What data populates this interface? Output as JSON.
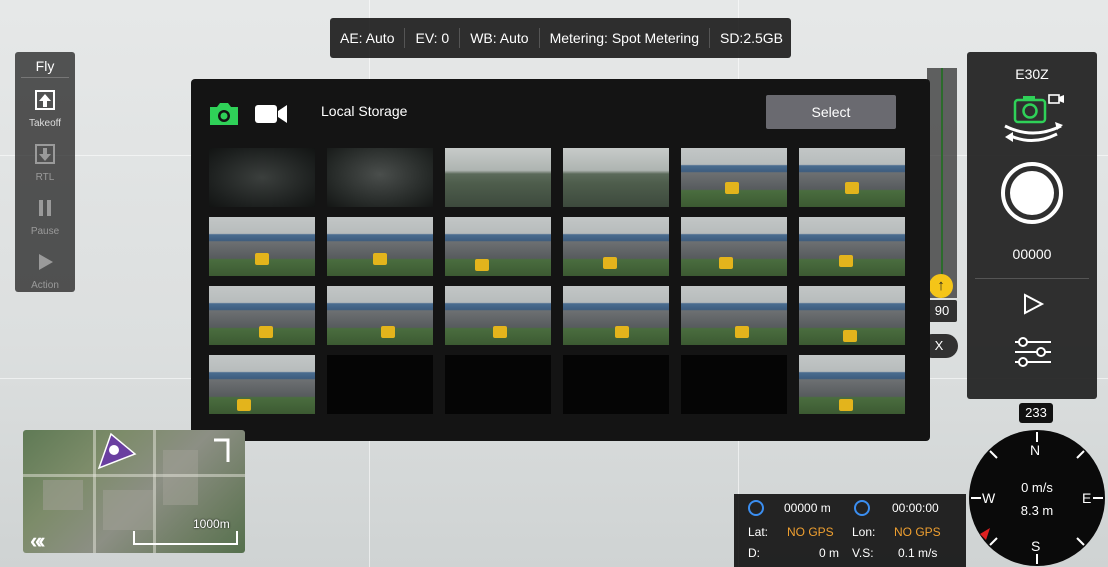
{
  "status_bar": {
    "ae": "AE: Auto",
    "ev": "EV: 0",
    "wb": "WB: Auto",
    "metering": "Metering: Spot Metering",
    "sd": "SD:2.5GB"
  },
  "fly_panel": {
    "title": "Fly",
    "takeoff": "Takeoff",
    "rtl": "RTL",
    "pause": "Pause",
    "action": "Action"
  },
  "camera_panel": {
    "model": "E30Z",
    "count": "00000",
    "accent": "#2fd158"
  },
  "altitude": {
    "value": "90",
    "x_label": "X"
  },
  "gallery": {
    "storage_label": "Local Storage",
    "select_label": "Select",
    "photo_icon": "camera-icon",
    "video_icon": "video-icon"
  },
  "map": {
    "scale_label": "1000m"
  },
  "telemetry": {
    "distance": "00000 m",
    "time": "00:00:00",
    "lat_label": "Lat:",
    "lat_value": "NO GPS",
    "lon_label": "Lon:",
    "lon_value": "NO GPS",
    "d_label": "D:",
    "d_value": "0 m",
    "vs_label": "V.S:",
    "vs_value": "0.1 m/s"
  },
  "compass": {
    "heading": "233",
    "n": "N",
    "s": "S",
    "e": "E",
    "w": "W",
    "speed": "0 m/s",
    "height": "8.3 m"
  }
}
